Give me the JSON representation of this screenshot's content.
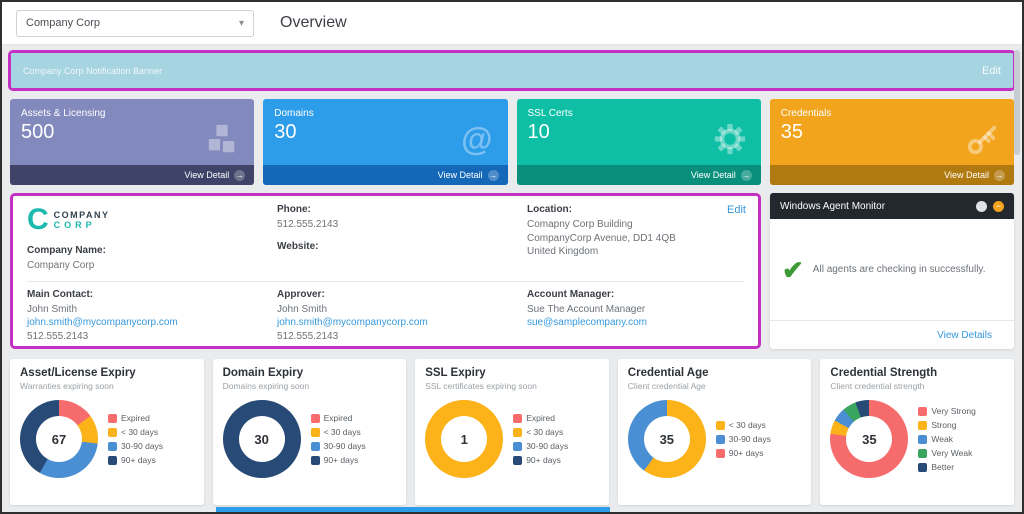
{
  "topbar": {
    "company_selector": "Company Corp",
    "title": "Overview"
  },
  "banner": {
    "text": "Company Corp Notification Banner",
    "edit_label": "Edit"
  },
  "colors": {
    "highlight": "#c42fc4",
    "link": "#3598db",
    "banner_bg": "#a6d4e0",
    "page_bg": "#e9ebed"
  },
  "stat_cards": [
    {
      "label": "Assets & Licensing",
      "value": "500",
      "icon": "cubes-icon",
      "footer_label": "View Detail",
      "bg": "#8289bd",
      "footer_bg": "#3e4367"
    },
    {
      "label": "Domains",
      "value": "30",
      "icon": "at-icon",
      "footer_label": "View Detail",
      "bg": "#2d9ce9",
      "footer_bg": "#1568b8"
    },
    {
      "label": "SSL Certs",
      "value": "10",
      "icon": "gear-icon",
      "footer_label": "View Detail",
      "bg": "#0fbfa5",
      "footer_bg": "#098f7c"
    },
    {
      "label": "Credentials",
      "value": "35",
      "icon": "key-icon",
      "footer_label": "View Detail",
      "bg": "#f2a41c",
      "footer_bg": "#b17a10"
    }
  ],
  "company_panel": {
    "edit_label": "Edit",
    "logo": {
      "line1": "COMPANY",
      "line2": "CORP"
    },
    "company_name_label": "Company Name:",
    "company_name": "Company Corp",
    "phone_label": "Phone:",
    "phone": "512.555.2143",
    "website_label": "Website:",
    "website_value": "",
    "location_label": "Location:",
    "location_lines": [
      "Comapny Corp Building",
      "CompanyCorp Avenue, DD1 4QB",
      "United Kingdom"
    ],
    "main_contact_label": "Main Contact:",
    "main_contact": {
      "name": "John Smith",
      "email": "john.smith@mycompanycorp.com",
      "phone": "512.555.2143"
    },
    "approver_label": "Approver:",
    "approver": {
      "name": "John Smith",
      "email": "john.smith@mycompanycorp.com",
      "phone": "512.555.2143"
    },
    "account_manager_label": "Account Manager:",
    "account_manager": {
      "name": "Sue The Account Manager",
      "email": "sue@samplecompany.com"
    }
  },
  "agent_monitor": {
    "title": "Windows Agent Monitor",
    "message": "All agents are checking in successfully.",
    "link_label": "View Details"
  },
  "chart_data": [
    {
      "type": "pie",
      "title": "Asset/License Expiry",
      "subtitle": "Warranties expiring soon",
      "center_value": "67",
      "legend_position": "right",
      "segments": [
        {
          "label": "Expired",
          "value": 10,
          "color": "#f66c6c"
        },
        {
          "label": "< 30 days",
          "value": 8,
          "color": "#fcb319"
        },
        {
          "label": "30-90 days",
          "value": 21,
          "color": "#4a8fd3"
        },
        {
          "label": "90+ days",
          "value": 28,
          "color": "#274a77"
        }
      ]
    },
    {
      "type": "pie",
      "title": "Domain Expiry",
      "subtitle": "Domains expiring soon",
      "center_value": "30",
      "legend_position": "right",
      "segments": [
        {
          "label": "Expired",
          "value": 0,
          "color": "#f66c6c"
        },
        {
          "label": "< 30 days",
          "value": 0,
          "color": "#fcb319"
        },
        {
          "label": "30-90 days",
          "value": 0,
          "color": "#4a8fd3"
        },
        {
          "label": "90+ days",
          "value": 30,
          "color": "#274a77"
        }
      ]
    },
    {
      "type": "pie",
      "title": "SSL Expiry",
      "subtitle": "SSL certificates expiring soon",
      "center_value": "1",
      "legend_position": "right",
      "segments": [
        {
          "label": "Expired",
          "value": 0,
          "color": "#f66c6c"
        },
        {
          "label": "< 30 days",
          "value": 1,
          "color": "#fcb319"
        },
        {
          "label": "30-90 days",
          "value": 0,
          "color": "#4a8fd3"
        },
        {
          "label": "90+ days",
          "value": 0,
          "color": "#274a77"
        }
      ]
    },
    {
      "type": "pie",
      "title": "Credential Age",
      "subtitle": "Client credential Age",
      "center_value": "35",
      "legend_position": "right",
      "segments": [
        {
          "label": "< 30 days",
          "value": 21,
          "color": "#fcb319"
        },
        {
          "label": "30-90 days",
          "value": 14,
          "color": "#4a8fd3"
        },
        {
          "label": "90+ days",
          "value": 0,
          "color": "#f66c6c"
        }
      ]
    },
    {
      "type": "pie",
      "title": "Credential Strength",
      "subtitle": "Client credential strength",
      "center_value": "35",
      "legend_position": "right",
      "segments": [
        {
          "label": "Very Strong",
          "value": 27,
          "color": "#f66c6c"
        },
        {
          "label": "Strong",
          "value": 2,
          "color": "#fcb319"
        },
        {
          "label": "Weak",
          "value": 2,
          "color": "#4a8fd3"
        },
        {
          "label": "Very Weak",
          "value": 2,
          "color": "#3aa55f"
        },
        {
          "label": "Better",
          "value": 2,
          "color": "#274a77"
        }
      ]
    }
  ]
}
